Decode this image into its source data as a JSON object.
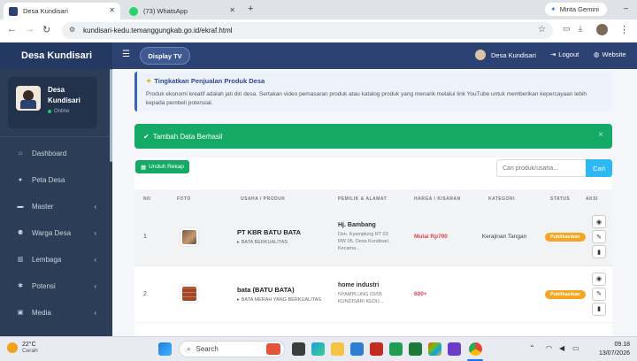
{
  "browser": {
    "tabs": [
      {
        "title": "Desa Kundisari",
        "active": true
      },
      {
        "title": "(73) WhatsApp",
        "active": false
      }
    ],
    "new_tab": "+",
    "gemini_label": "Minta Gemini",
    "url": "kundisari-kedu.temanggungkab.go.id/ekraf.html",
    "window_controls": [
      "–",
      "▢",
      "✕"
    ]
  },
  "topnav": {
    "brand": "Desa Kundisari",
    "menu_icon": "hamburger-icon",
    "display_tv": "Display TV",
    "user_name": "Desa Kundisari",
    "logout": "Logout",
    "website": "Website"
  },
  "sidebar": {
    "profile_name_line1": "Desa",
    "profile_name_line2": "Kundisari",
    "status": "Online",
    "items": [
      {
        "label": "Dashboard",
        "icon": "home-icon",
        "has_children": false
      },
      {
        "label": "Peta Desa",
        "icon": "map-marker-icon",
        "has_children": false
      },
      {
        "label": "Master",
        "icon": "gears-icon",
        "has_children": true
      },
      {
        "label": "Warga Desa",
        "icon": "users-icon",
        "has_children": true
      },
      {
        "label": "Lembaga",
        "icon": "institution-icon",
        "has_children": true
      },
      {
        "label": "Potensi",
        "icon": "star-icon",
        "has_children": true
      },
      {
        "label": "Media",
        "icon": "media-icon",
        "has_children": true
      }
    ]
  },
  "info": {
    "title": "Tingkatkan Penjualan Produk Desa",
    "text": "Produk ekonomi kreatif adalah jati diri desa. Sertakan video pemasaran produk atau katalog produk yang menarik melalui link YouTube untuk memberikan kepercayaan lebih kepada pembeli potensial."
  },
  "alert": {
    "text": "Tambah Data Berhasil",
    "close": "×"
  },
  "toolbar": {
    "download_label": "Unduh Rekap",
    "search_placeholder": "Cari produk/usaha...",
    "search_button": "Cari"
  },
  "table": {
    "headers": [
      "NO",
      "FOTO",
      "USAHA / PRODUK",
      "PEMILIK & ALAMAT",
      "HARGA / KISARAN",
      "KATEGORI",
      "STATUS",
      "AKSI"
    ],
    "rows": [
      {
        "no": "1",
        "name": "PT KBR BATU BATA",
        "sub": "BATA BERKUALITAS",
        "owner": "Hj. Bambang",
        "address": "Dsn. Kyamplung RT 03 RW 05, Desa Kundisari, Kecama...",
        "price": "Mulai Rp700",
        "category": "Kerajinan Tangan",
        "status": "Publikasikan"
      },
      {
        "no": "2",
        "name": "bata (BATU BATA)",
        "sub": "BATA MERAH YANG BERKUALITAS",
        "owner": "home industri",
        "address": "NYAMPLUNG 03/05 KUNDISARI KEDU...",
        "price": "600+",
        "category": "",
        "status": "Publikasikan"
      }
    ]
  },
  "taskbar": {
    "temperature": "22°C",
    "weather": "Cerah",
    "search": "Search",
    "time": "09.18",
    "date": "13/07/2026"
  }
}
